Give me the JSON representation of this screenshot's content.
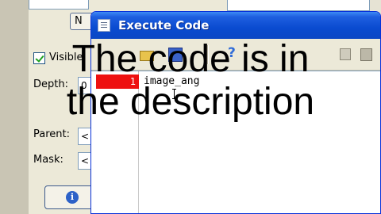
{
  "background": {
    "button_top_label": "N",
    "checkbox_label": "Visible",
    "depth_label": "Depth:",
    "depth_value": "0",
    "parent_label": "Parent:",
    "parent_value": "<",
    "mask_label": "Mask:",
    "mask_value": "<",
    "bottom_button_icon": "info-icon"
  },
  "window": {
    "title": "Execute Code",
    "toolbar_icons": [
      "open-icon",
      "save-icon",
      "help-icon",
      "copy-icon",
      "paste-icon"
    ]
  },
  "editor": {
    "line_number": "1",
    "code_text": "image_ang"
  },
  "overlay": {
    "line1": "The code is in",
    "line2": "the description"
  },
  "colors": {
    "titlebar": "#0a4bd0",
    "line_marker": "#ee1111",
    "background": "#ece9d8"
  }
}
